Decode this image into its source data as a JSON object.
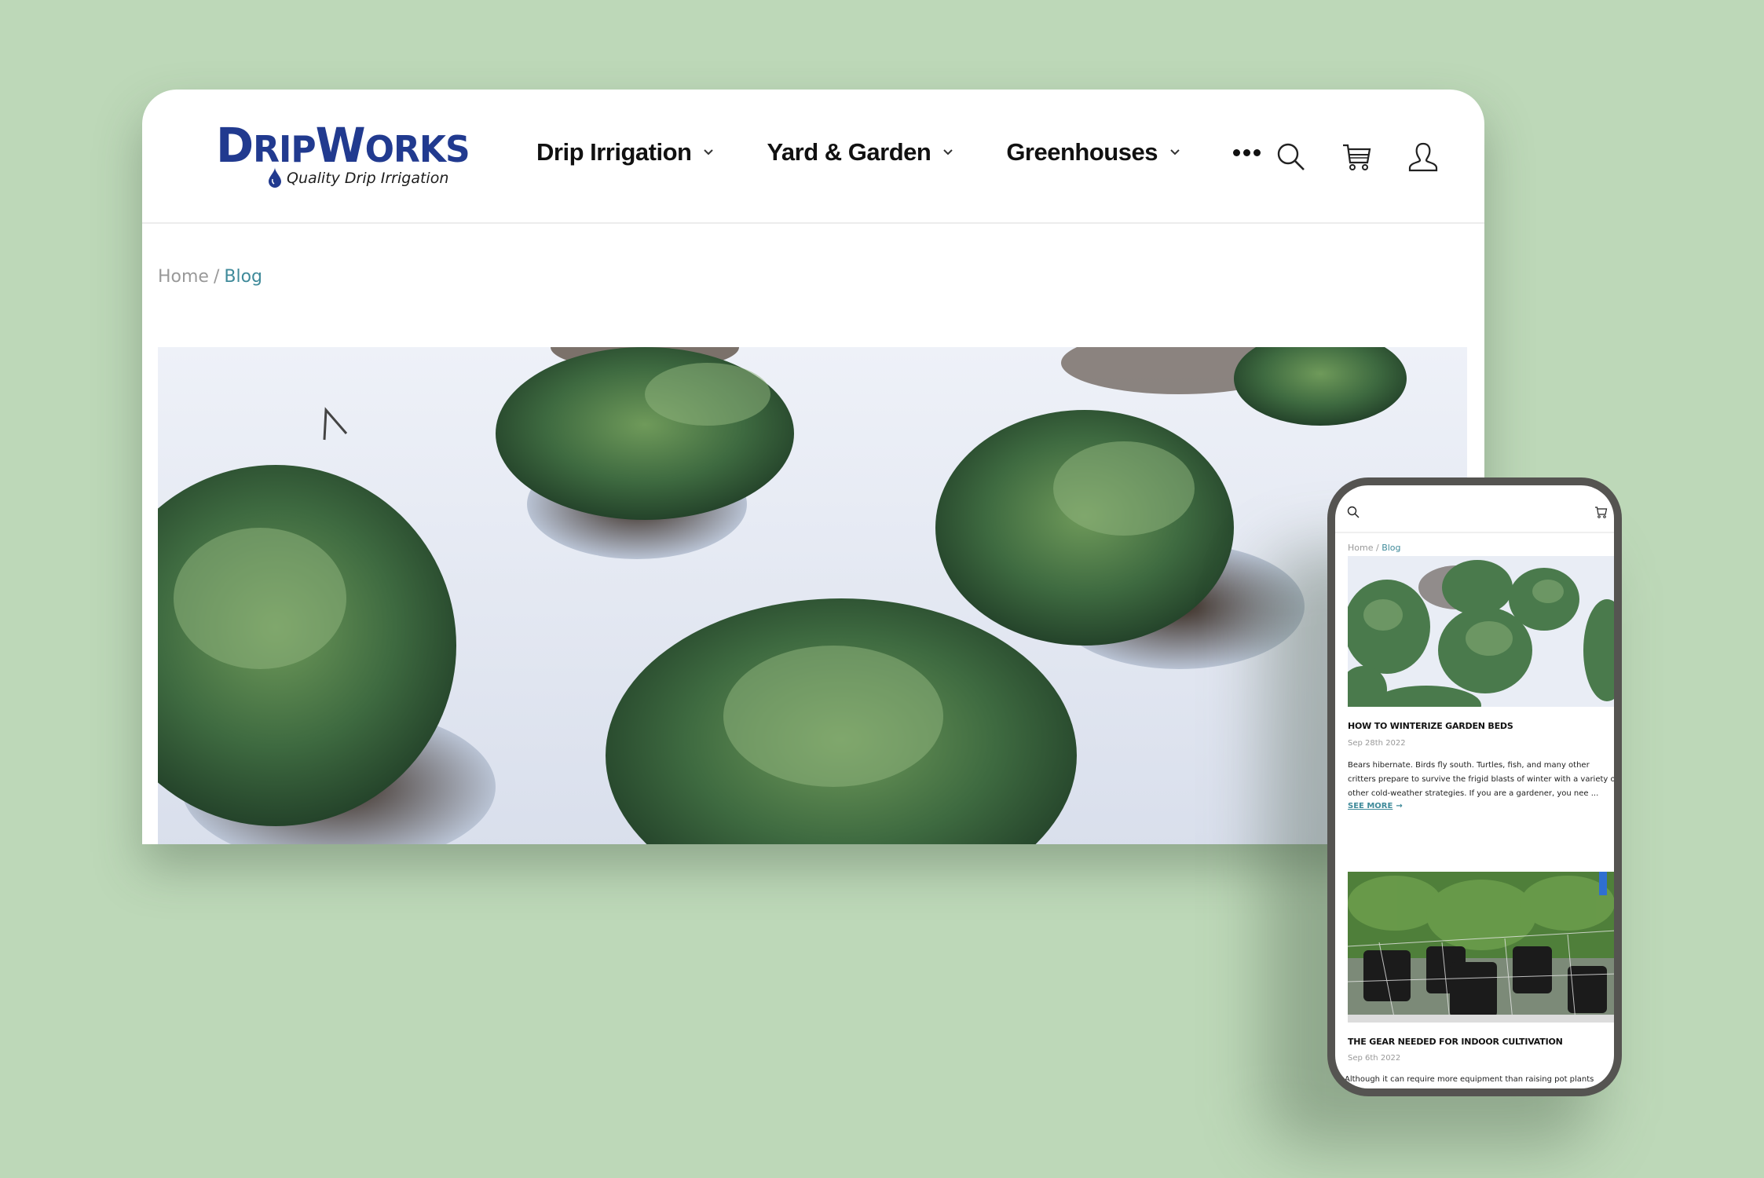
{
  "colors": {
    "background": "#bdd8b8",
    "brand_blue": "#213a8f",
    "link_teal": "#3f8a9a",
    "phone_bezel": "#555451"
  },
  "desktop": {
    "logo": {
      "name_big_1": "D",
      "name_small_1": "RIP",
      "name_big_2": "W",
      "name_small_2": "ORKS",
      "tagline": "Quality Drip Irrigation",
      "drop_icon": "water-drop-icon"
    },
    "nav": {
      "items": [
        {
          "label": "Drip Irrigation",
          "icon": "chevron-down-icon"
        },
        {
          "label": "Yard & Garden",
          "icon": "chevron-down-icon"
        },
        {
          "label": "Greenhouses",
          "icon": "chevron-down-icon"
        }
      ],
      "more_icon": "more-horizontal-icon"
    },
    "header_icons": [
      "search-icon",
      "cart-icon",
      "user-icon"
    ],
    "breadcrumb": {
      "home": "Home",
      "separator": "/",
      "current": "Blog"
    },
    "hero_image": "cabbages-in-snow"
  },
  "mobile": {
    "header_icons": [
      "search-icon",
      "cart-icon"
    ],
    "breadcrumb": {
      "home": "Home",
      "separator": "/",
      "current": "Blog"
    },
    "posts": [
      {
        "image": "cabbages-in-snow",
        "title": "HOW TO WINTERIZE GARDEN BEDS",
        "date": "Sep 28th 2022",
        "excerpt": "Bears hibernate. Birds fly south. Turtles, fish, and many other critters prepare to survive the frigid blasts of winter with a variety of other cold-weather strategies. If you are a gardener, you nee ...",
        "link": "SEE MORE",
        "link_arrow": "→"
      },
      {
        "image": "indoor-cultivation-pots",
        "title": "THE GEAR NEEDED FOR INDOOR CULTIVATION",
        "date": "Sep 6th 2022",
        "excerpt": "Although it can require more equipment than raising pot plants"
      }
    ]
  }
}
